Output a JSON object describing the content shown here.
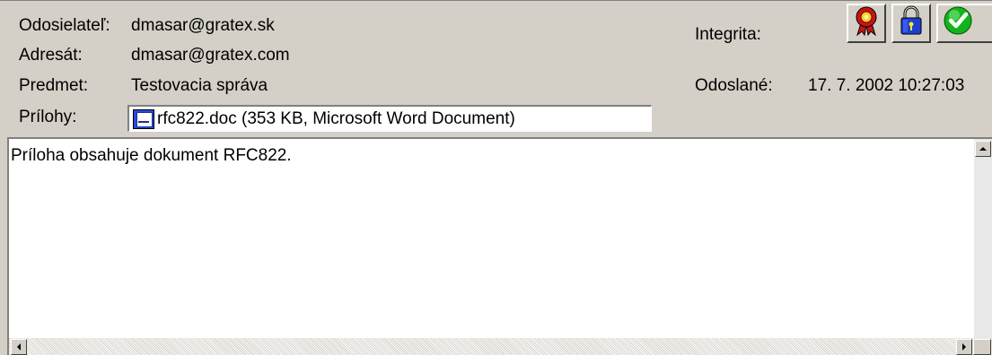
{
  "header": {
    "sender_label": "Odosielateľ:",
    "sender_value": "dmasar@gratex.sk",
    "recipient_label": "Adresát:",
    "recipient_value": "dmasar@gratex.com",
    "subject_label": "Predmet:",
    "subject_value": "Testovacia správa",
    "attachments_label": "Prílohy:",
    "attachment_value": "rfc822.doc (353 KB, Microsoft Word Document)",
    "integrity_label": "Integrita:",
    "sent_label": "Odoslané:",
    "sent_value": "17. 7. 2002 10:27:03"
  },
  "icons": [
    "certificate-icon",
    "lock-icon",
    "checkmark-icon",
    "word-document-icon"
  ],
  "body": {
    "text": "Príloha obsahuje dokument RFC822."
  },
  "colors": {
    "window_bg": "#d4d0c8",
    "field_bg": "#ffffff",
    "check_green": "#11b51a",
    "lock_blue": "#1f3fd0",
    "cert_red": "#c81414"
  }
}
